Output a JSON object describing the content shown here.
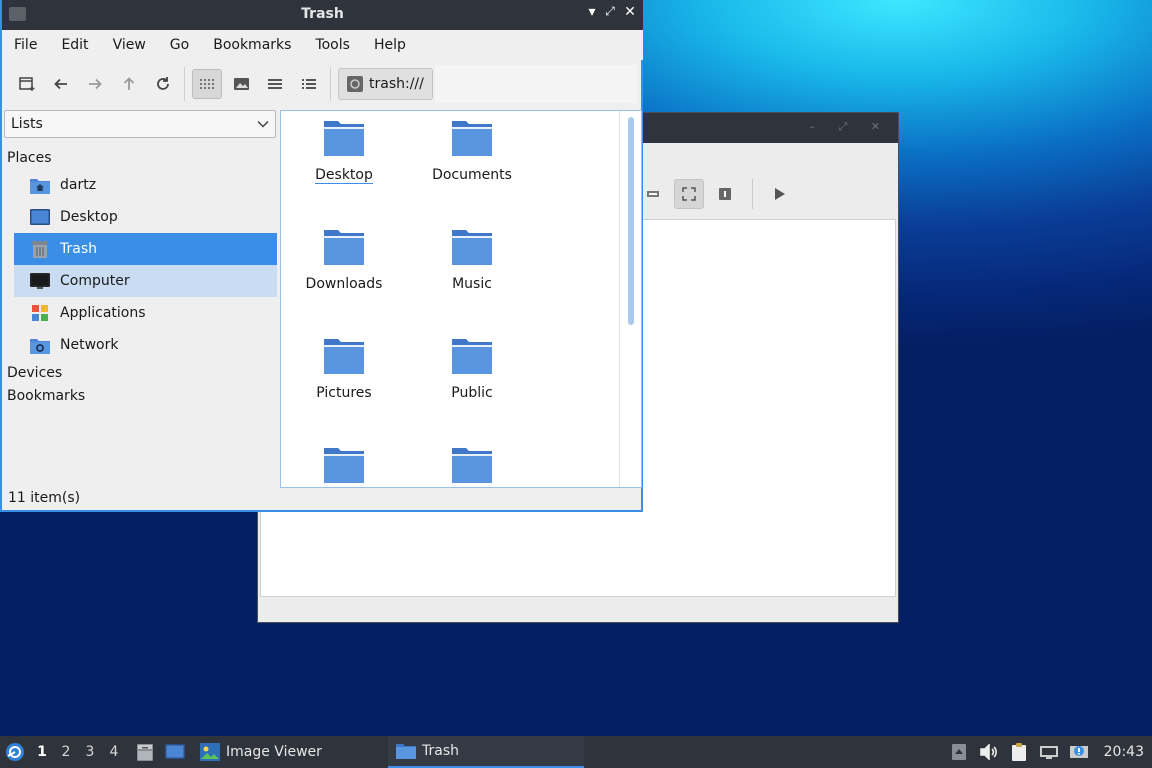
{
  "colors": {
    "accent": "#3a8ee6",
    "folder": "#4a86d4",
    "titlebar": "#2f343c"
  },
  "window": {
    "title": "Trash",
    "controls": {
      "minimize": "▾",
      "maximize": "⤢",
      "close": "✕"
    }
  },
  "menu": [
    "File",
    "Edit",
    "View",
    "Go",
    "Bookmarks",
    "Tools",
    "Help"
  ],
  "toolbar": {
    "buttons": [
      "new-tab-icon",
      "back-arrow-icon",
      "forward-arrow-icon",
      "up-arrow-icon",
      "reload-icon",
      "icon-view-icon",
      "thumbnail-view-icon",
      "compact-view-icon",
      "detailed-list-icon"
    ],
    "location": "trash:///"
  },
  "sidebar": {
    "mode": "Lists",
    "places_header": "Places",
    "places": [
      {
        "label": "dartz",
        "icon": "home-folder-icon"
      },
      {
        "label": "Desktop",
        "icon": "desktop-icon"
      },
      {
        "label": "Trash",
        "icon": "trash-icon"
      },
      {
        "label": "Computer",
        "icon": "computer-icon"
      },
      {
        "label": "Applications",
        "icon": "applications-icon"
      },
      {
        "label": "Network",
        "icon": "network-icon"
      }
    ],
    "devices_header": "Devices",
    "bookmarks_header": "Bookmarks"
  },
  "files": [
    "Desktop",
    "Documents",
    "Downloads",
    "Music",
    "Pictures",
    "Public",
    "",
    ""
  ],
  "status": "11 item(s)",
  "taskbar": {
    "workspaces": [
      "1",
      "2",
      "3",
      "4"
    ],
    "tasks": [
      {
        "label": "Image Viewer",
        "icon": "image-viewer-icon"
      },
      {
        "label": "Trash",
        "icon": "folder-icon"
      }
    ],
    "clock": "20:43"
  }
}
